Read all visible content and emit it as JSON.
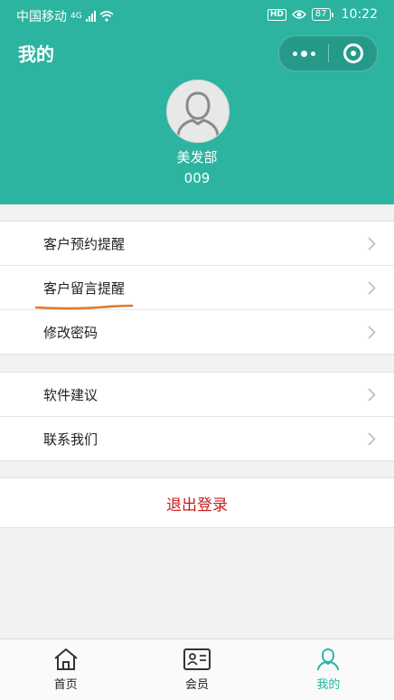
{
  "statusbar": {
    "carrier": "中国移动",
    "network": "4G",
    "hd": "HD",
    "battery": "87",
    "time": "10:22"
  },
  "header": {
    "title": "我的",
    "bg_color": "#2cb4a0"
  },
  "profile": {
    "name": "美发部",
    "id": "009"
  },
  "menu_group_1": [
    {
      "label": "客户预约提醒"
    },
    {
      "label": "客户留言提醒"
    },
    {
      "label": "修改密码"
    }
  ],
  "menu_group_2": [
    {
      "label": "软件建议"
    },
    {
      "label": "联系我们"
    }
  ],
  "logout": {
    "label": "退出登录",
    "color": "#c81c1c"
  },
  "tabbar": {
    "tabs": [
      {
        "label": "首页",
        "icon": "home-icon"
      },
      {
        "label": "会员",
        "icon": "member-card-icon"
      },
      {
        "label": "我的",
        "icon": "user-icon",
        "active": true
      }
    ]
  },
  "annotation_color": "#e07a2e"
}
